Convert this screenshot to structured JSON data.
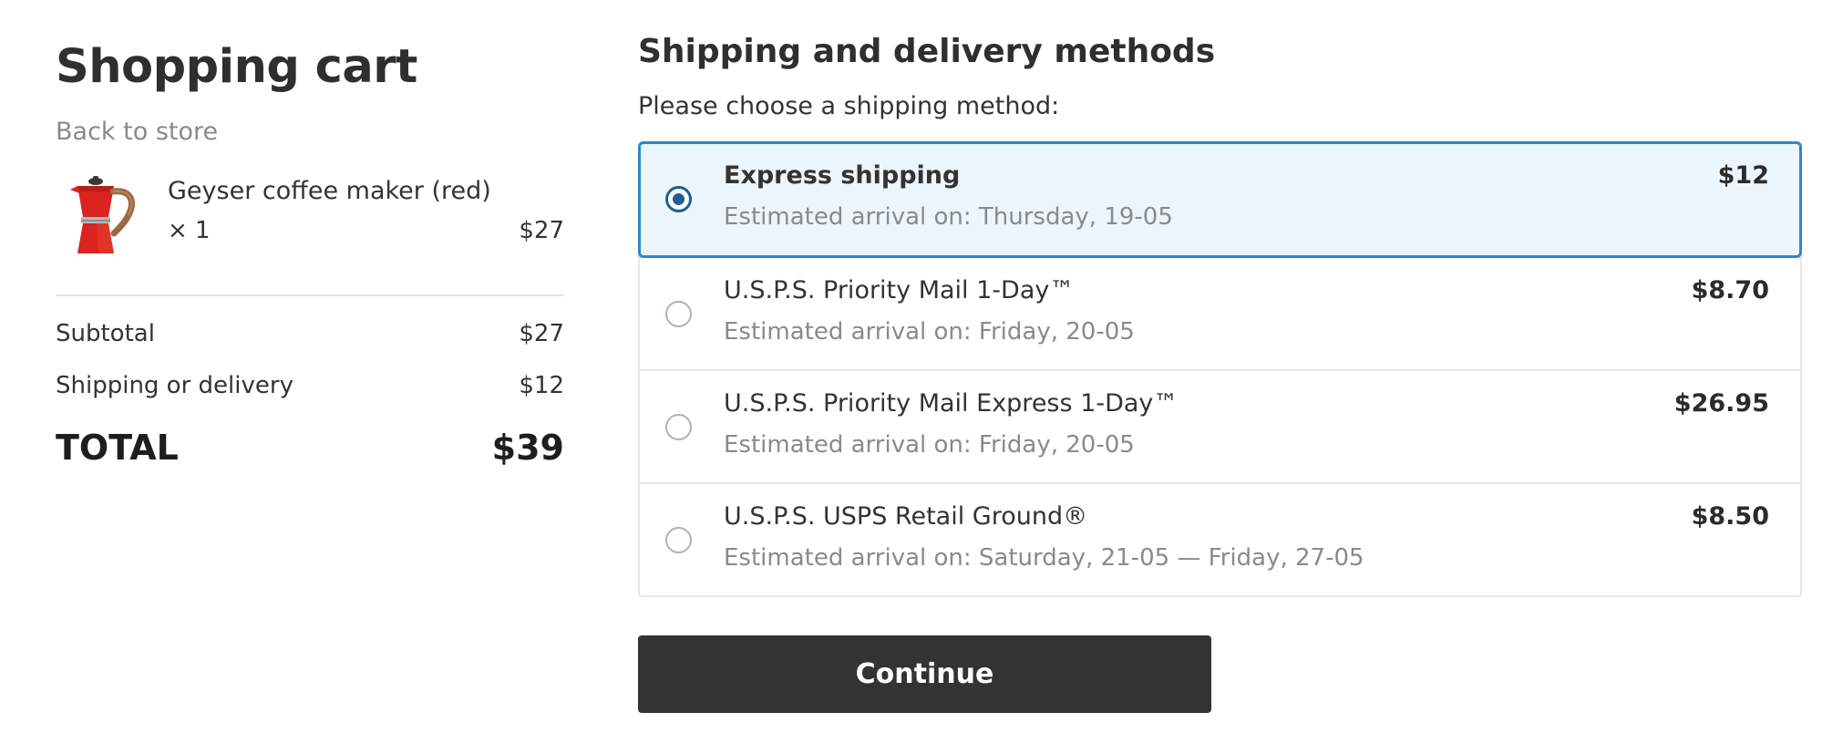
{
  "cart": {
    "title": "Shopping cart",
    "back_link": "Back to store",
    "items": [
      {
        "name": "Geyser coffee maker (red)",
        "quantity": "× 1",
        "price": "$27",
        "image_icon": "red-moka-pot-image"
      }
    ],
    "summary": {
      "subtotal_label": "Subtotal",
      "subtotal_value": "$27",
      "shipping_label": "Shipping or delivery",
      "shipping_value": "$12",
      "total_label": "TOTAL",
      "total_value": "$39"
    }
  },
  "shipping": {
    "title": "Shipping and delivery methods",
    "prompt": "Please choose a shipping method:",
    "methods": [
      {
        "name": "Express shipping",
        "eta": "Estimated arrival on: Thursday, 19-05",
        "price": "$12",
        "selected": true
      },
      {
        "name": "U.S.P.S. Priority Mail 1-Day™",
        "eta": "Estimated arrival on: Friday, 20-05",
        "price": "$8.70",
        "selected": false
      },
      {
        "name": "U.S.P.S. Priority Mail Express 1-Day™",
        "eta": "Estimated arrival on: Friday, 20-05",
        "price": "$26.95",
        "selected": false
      },
      {
        "name": "U.S.P.S. USPS Retail Ground®",
        "eta": "Estimated arrival on: Saturday, 21-05 — Friday, 27-05",
        "price": "$8.50",
        "selected": false
      }
    ],
    "continue_label": "Continue"
  },
  "colors": {
    "accent": "#2f86c8",
    "radio_selected": "#1d5f96",
    "selected_bg": "#ecf5fc",
    "button_bg": "#333333",
    "product_red": "#d9241f"
  }
}
